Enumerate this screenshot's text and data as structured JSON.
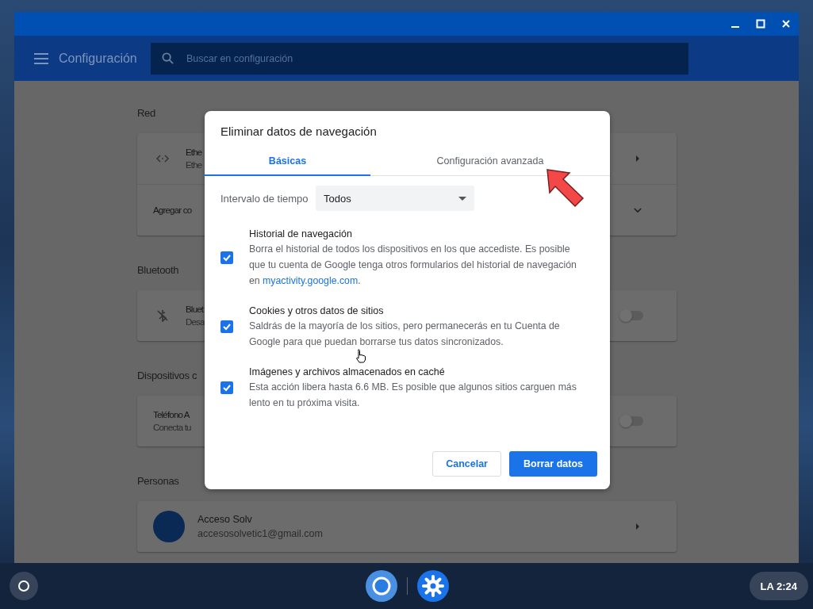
{
  "header": {
    "title": "Configuración",
    "search": {
      "placeholder": "Buscar en configuración"
    }
  },
  "sections": [
    {
      "title": "Red",
      "rows": [
        {
          "kind": "network",
          "title": "Ethe",
          "subtitle": "Ethe"
        },
        {
          "kind": "expand",
          "title": "Agregar co"
        }
      ]
    },
    {
      "title": "Bluetooth",
      "rows": [
        {
          "kind": "bluetooth",
          "title": "Bluet",
          "subtitle": "Desa",
          "on": false
        }
      ]
    },
    {
      "title": "Dispositivos c",
      "rows": [
        {
          "kind": "toggle",
          "title": "Teléfono A",
          "subtitle": "Conecta tu",
          "on": false
        }
      ]
    },
    {
      "title": "Personas",
      "rows": [
        {
          "kind": "account",
          "title": "Acceso Solv",
          "subtitle": "accesosolvetic1@gmail.com"
        }
      ]
    }
  ],
  "dialog": {
    "title": "Eliminar datos de navegación",
    "tabs": [
      {
        "label": "Básicas",
        "selected": true
      },
      {
        "label": "Configuración avanzada",
        "selected": false
      }
    ],
    "time_range": {
      "label": "Intervalo de tiempo",
      "value": "Todos"
    },
    "items": [
      {
        "title": "Historial de navegación",
        "description": "Borra el historial de todos los dispositivos en los que accediste. Es posible que tu cuenta de Google tenga otros formularios del historial de navegación en ",
        "link": "myactivity.google.com",
        "description_end": ".",
        "checked": true
      },
      {
        "title": "Cookies y otros datos de sitios",
        "description": "Saldrás de la mayoría de los sitios, pero permanecerás en tu Cuenta de Google para que puedan borrarse tus datos sincronizados.",
        "checked": true
      },
      {
        "title": "Imágenes y archivos almacenados en caché",
        "description": "Esta acción libera hasta 6.6 MB. Es posible que algunos sitios carguen más lento en tu próxima visita.",
        "checked": true
      }
    ],
    "buttons": [
      {
        "kind": "secondary",
        "label": "Cancelar"
      },
      {
        "kind": "primary",
        "label": "Borrar datos"
      }
    ]
  },
  "taskbar": {
    "status": "LA 2:24"
  }
}
